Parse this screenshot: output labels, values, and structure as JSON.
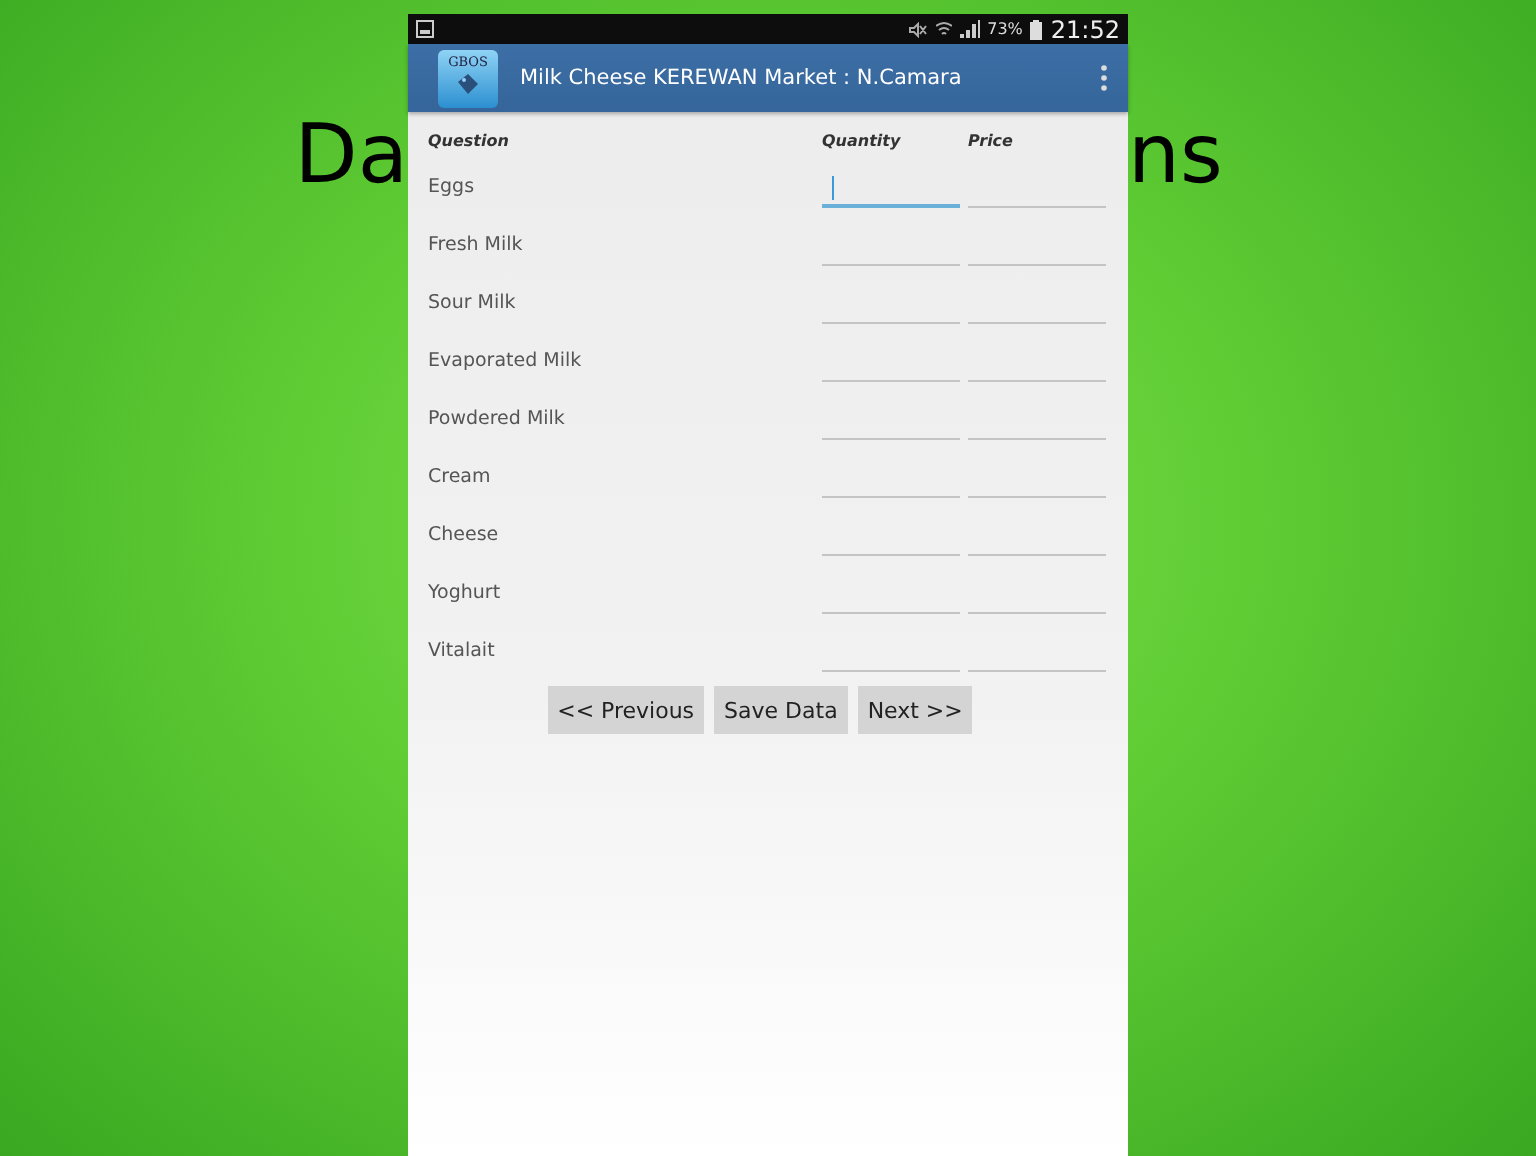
{
  "slide": {
    "title_parts": [
      "Da",
      "ns"
    ]
  },
  "status_bar": {
    "battery": "73%",
    "time": "21:52"
  },
  "app_bar": {
    "logo_text": "GBOS",
    "title": "Milk Cheese KEREWAN Market : N.Camara"
  },
  "form": {
    "columns": [
      "Question",
      "Quantity",
      "Price"
    ],
    "rows": [
      {
        "label": "Eggs",
        "quantity_focused": true,
        "price_focused": false
      },
      {
        "label": "Fresh Milk",
        "quantity_focused": false,
        "price_focused": false
      },
      {
        "label": "Sour Milk",
        "quantity_focused": false,
        "price_focused": false
      },
      {
        "label": "Evaporated Milk",
        "quantity_focused": false,
        "price_focused": false
      },
      {
        "label": "Powdered Milk",
        "quantity_focused": false,
        "price_focused": false
      },
      {
        "label": "Cream",
        "quantity_focused": false,
        "price_focused": false
      },
      {
        "label": "Cheese",
        "quantity_focused": false,
        "price_focused": false
      },
      {
        "label": "Yoghurt",
        "quantity_focused": false,
        "price_focused": false
      },
      {
        "label": "Vitalait",
        "quantity_focused": false,
        "price_focused": false
      }
    ],
    "buttons": [
      "<< Previous",
      "Save Data",
      "Next >>"
    ]
  }
}
